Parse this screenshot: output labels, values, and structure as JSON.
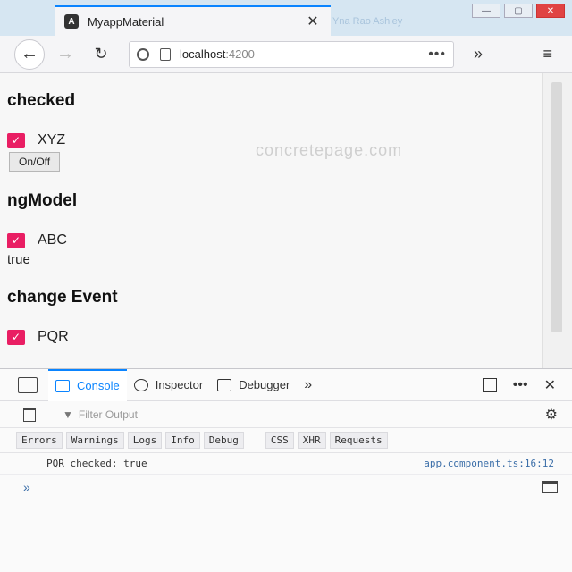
{
  "browser": {
    "tab": {
      "title": "MyappMaterial",
      "close": "✕",
      "favicon": "A"
    },
    "ghost_tab_text": "Yna Rao Ashley",
    "window_controls": {
      "minimize": "—",
      "maximize": "▢",
      "close": "✕"
    },
    "nav": {
      "back": "←",
      "forward": "→",
      "reload": "↻",
      "overflow": "»",
      "menu": "≡"
    },
    "url": {
      "host": "localhost",
      "port": ":4200",
      "more": "•••"
    }
  },
  "page": {
    "watermark": "concretepage.com",
    "sections": {
      "checked": {
        "heading": "checked",
        "checkbox_label": "XYZ",
        "button_label": "On/Off"
      },
      "ngmodel": {
        "heading": "ngModel",
        "checkbox_label": "ABC",
        "value": "true"
      },
      "change_event": {
        "heading": "change Event",
        "checkbox_label": "PQR"
      }
    },
    "checkmark": "✓"
  },
  "devtools": {
    "tabs": [
      {
        "label": "Console"
      },
      {
        "label": "Inspector"
      },
      {
        "label": "Debugger"
      }
    ],
    "overflow": "»",
    "more": "•••",
    "close": "✕",
    "filter": {
      "icon": "▼",
      "placeholder": "Filter Output"
    },
    "gear": "⚙",
    "chips": [
      "Errors",
      "Warnings",
      "Logs",
      "Info",
      "Debug",
      "CSS",
      "XHR",
      "Requests"
    ],
    "message": {
      "text": "PQR checked: true",
      "source": "app.component.ts:16:12"
    },
    "prompt": "»"
  },
  "colors": {
    "accent": "#0a84ff",
    "checkbox": "#e91e63"
  }
}
